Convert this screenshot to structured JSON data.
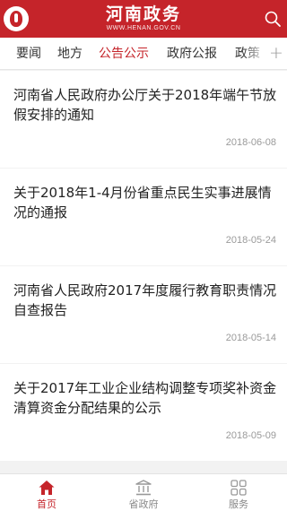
{
  "header": {
    "brand_name": "河南政务",
    "brand_url": "WWW.HENAN.GOV.CN",
    "search_icon": "search-icon",
    "logo_icon": "henan-logo-icon"
  },
  "tabs": [
    {
      "label": "要闻",
      "active": false
    },
    {
      "label": "地方",
      "active": false
    },
    {
      "label": "公告公示",
      "active": true
    },
    {
      "label": "政府公报",
      "active": false
    },
    {
      "label": "政策",
      "active": false
    }
  ],
  "tabs_more": "+",
  "articles": [
    {
      "title": "河南省人民政府办公厅关于2018年端午节放假安排的通知",
      "date": "2018-06-08"
    },
    {
      "title": "关于2018年1-4月份省重点民生实事进展情况的通报",
      "date": "2018-05-24"
    },
    {
      "title": "河南省人民政府2017年度履行教育职责情况自查报告",
      "date": "2018-05-14"
    },
    {
      "title": "关于2017年工业企业结构调整专项奖补资金清算资金分配结果的公示",
      "date": "2018-05-09"
    }
  ],
  "bottom_nav": [
    {
      "label": "首页",
      "icon": "home-icon",
      "active": true
    },
    {
      "label": "省政府",
      "icon": "government-building-icon",
      "active": false
    },
    {
      "label": "服务",
      "icon": "grid-icon",
      "active": false
    }
  ],
  "colors": {
    "accent": "#c5242a",
    "background": "#f2f2f2",
    "date_text": "#9a9a9a"
  }
}
